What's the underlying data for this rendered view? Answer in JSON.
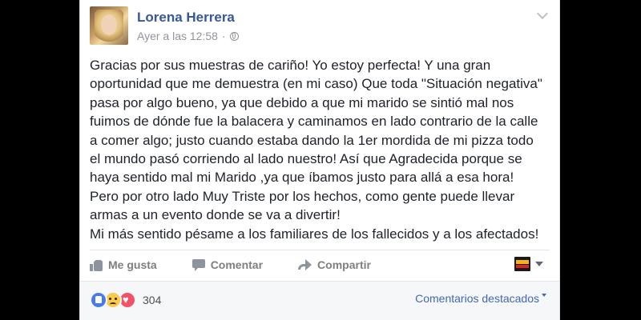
{
  "post": {
    "author": "Lorena Herrera",
    "timestamp": "Ayer a las 12:58",
    "separator": "·",
    "privacy_icon": "globe-icon",
    "text": "Gracias por sus muestras de cariño! Yo estoy perfecta! Y una gran\noportunidad que me demuestra (en mi caso) Que toda \"Situación negativa\"\npasa por algo bueno, ya que debido a que mi marido se sintió mal nos\nfuimos de dónde fue la balacera y caminamos en lado contrario de la calle\na comer algo; justo cuando estaba dando la 1er mordida de mi pizza todo\nel mundo pasó corriendo al lado nuestro! Así que Agradecida porque se\nhaya sentido mal mi Marido ,ya que íbamos justo para allá a esa hora!\nPero por otro lado Muy Triste por los hechos, como gente puede llevar\narmas a un evento donde se va a divertir!\nMi más sentido pésame a los familiares de los fallecidos y a los afectados!"
  },
  "actions": {
    "like_label": "Me gusta",
    "comment_label": "Comentar",
    "share_label": "Compartir"
  },
  "reactions": {
    "types": [
      "like",
      "sad",
      "love"
    ],
    "count": "304"
  },
  "comments": {
    "sort_label": "Comentarios destacados"
  },
  "colors": {
    "link_blue": "#365899",
    "action_gray": "#7f7f7f",
    "background": "#000000"
  }
}
